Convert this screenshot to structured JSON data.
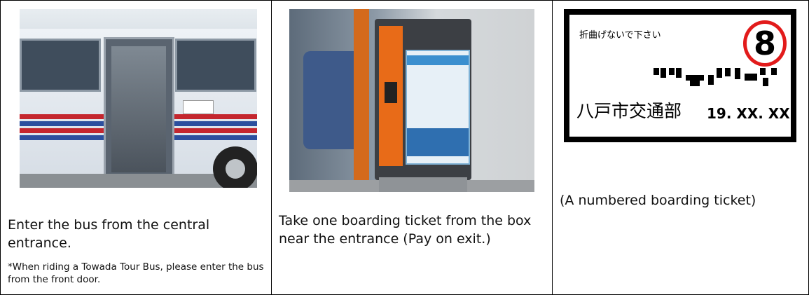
{
  "steps": [
    {
      "caption": "Enter the bus from the central entrance.",
      "note": "*When riding a Towada Tour Bus, please enter the bus from the front door."
    },
    {
      "caption": "Take one boarding ticket from the box near the entrance (Pay on exit.)"
    },
    {
      "caption": "(A numbered boarding ticket)",
      "ticket": {
        "warning": "折曲げないで下さい",
        "number": "8",
        "issuer": "八戸市交通部",
        "date": "19. XX. XX"
      }
    }
  ],
  "colors": {
    "ticket_circle": "#e21b1b",
    "machine_orange": "#e86b18",
    "bus_red_stripe": "#c4262e",
    "bus_blue_stripe": "#2c4f9e"
  }
}
